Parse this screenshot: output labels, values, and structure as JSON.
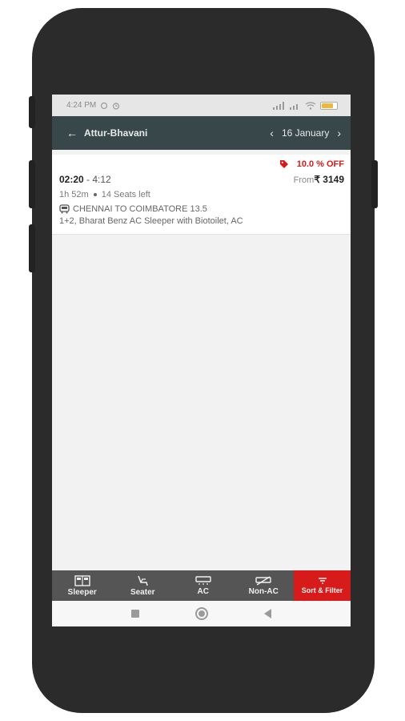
{
  "status_bar": {
    "time": "4:24 PM"
  },
  "toolbar": {
    "back_arrow": "←",
    "route": "Attur-Bhavani",
    "prev_arrow": "‹",
    "date": "16 January",
    "next_arrow": "›"
  },
  "bus": {
    "offer": "10.0 % OFF",
    "departure": "02:20",
    "arrival": "- 4:12",
    "price_prefix": "From",
    "price": "₹ 3149",
    "duration": "1h 52m",
    "seats": "14 Seats left",
    "name": "CHENNAI TO COIMBATORE 13.5",
    "type": "1+2,  Bharat Benz AC Sleeper with Biotoilet, AC"
  },
  "filters": [
    {
      "label": "Sleeper",
      "icon": "sleeper-icon"
    },
    {
      "label": "Seater",
      "icon": "seater-icon"
    },
    {
      "label": "AC",
      "icon": "ac-icon"
    },
    {
      "label": "Non-AC",
      "icon": "non-ac-icon"
    },
    {
      "label": "Sort & Filter",
      "icon": "filter-icon",
      "active": true
    }
  ],
  "colors": {
    "toolbar": "#37474a",
    "accent_red": "#d71a1a",
    "bottom_bar": "#555555"
  }
}
